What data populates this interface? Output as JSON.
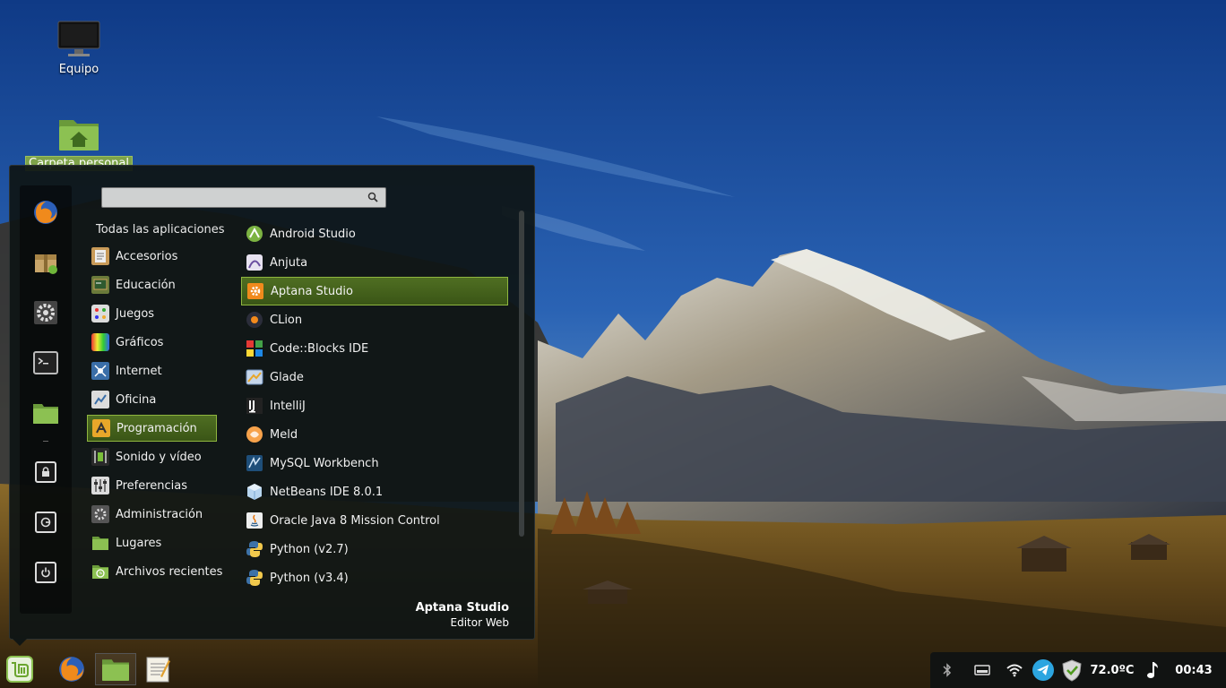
{
  "desktop": {
    "icons": [
      {
        "label": "Equipo"
      },
      {
        "label": "Carpeta personal"
      }
    ]
  },
  "menu": {
    "search": {
      "value": "",
      "placeholder": ""
    },
    "all_apps_label": "Todas las aplicaciones",
    "categories": [
      {
        "label": "Accesorios",
        "icon": "accessories-icon"
      },
      {
        "label": "Educación",
        "icon": "education-icon"
      },
      {
        "label": "Juegos",
        "icon": "games-icon"
      },
      {
        "label": "Gráficos",
        "icon": "graphics-icon"
      },
      {
        "label": "Internet",
        "icon": "internet-icon"
      },
      {
        "label": "Oficina",
        "icon": "office-icon"
      },
      {
        "label": "Programación",
        "icon": "programming-icon",
        "selected": true
      },
      {
        "label": "Sonido y vídeo",
        "icon": "sound-video-icon"
      },
      {
        "label": "Preferencias",
        "icon": "preferences-icon"
      },
      {
        "label": "Administración",
        "icon": "administration-icon"
      },
      {
        "label": "Lugares",
        "icon": "places-folder-icon"
      },
      {
        "label": "Archivos recientes",
        "icon": "recent-files-icon"
      }
    ],
    "apps": [
      {
        "label": "Android Studio",
        "icon": "android-studio-icon"
      },
      {
        "label": "Anjuta",
        "icon": "anjuta-icon"
      },
      {
        "label": "Aptana Studio",
        "icon": "aptana-icon",
        "selected": true
      },
      {
        "label": "CLion",
        "icon": "clion-icon"
      },
      {
        "label": "Code::Blocks IDE",
        "icon": "codeblocks-icon"
      },
      {
        "label": "Glade",
        "icon": "glade-icon"
      },
      {
        "label": "IntelliJ",
        "icon": "intellij-icon"
      },
      {
        "label": "Meld",
        "icon": "meld-icon"
      },
      {
        "label": "MySQL Workbench",
        "icon": "mysql-workbench-icon"
      },
      {
        "label": "NetBeans IDE 8.0.1",
        "icon": "netbeans-icon"
      },
      {
        "label": "Oracle Java 8 Mission Control",
        "icon": "java-icon"
      },
      {
        "label": "Python (v2.7)",
        "icon": "python-icon"
      },
      {
        "label": "Python (v3.4)",
        "icon": "python-icon"
      }
    ],
    "selected_app": {
      "name": "Aptana Studio",
      "description": "Editor Web"
    },
    "favorites": [
      "firefox-icon",
      "software-manager-icon",
      "system-settings-icon",
      "terminal-icon",
      "files-folder-icon"
    ],
    "session_buttons": [
      "lock-icon",
      "logout-icon",
      "power-icon"
    ]
  },
  "panel": {
    "launchers": [
      "mint-menu-icon",
      "firefox-icon",
      "files-folder-icon",
      "text-editor-icon"
    ],
    "tray": {
      "icons": [
        "bluetooth-icon",
        "removable-drive-icon",
        "wifi-icon",
        "telegram-icon",
        "update-shield-icon"
      ],
      "temperature": "72.0ºC",
      "sound_icon": "music-note-icon",
      "clock": "00:43"
    }
  },
  "colors": {
    "selection_green": "#8fb63f",
    "menu_bg": "#0e1414",
    "sky": "#1d4f9c"
  }
}
